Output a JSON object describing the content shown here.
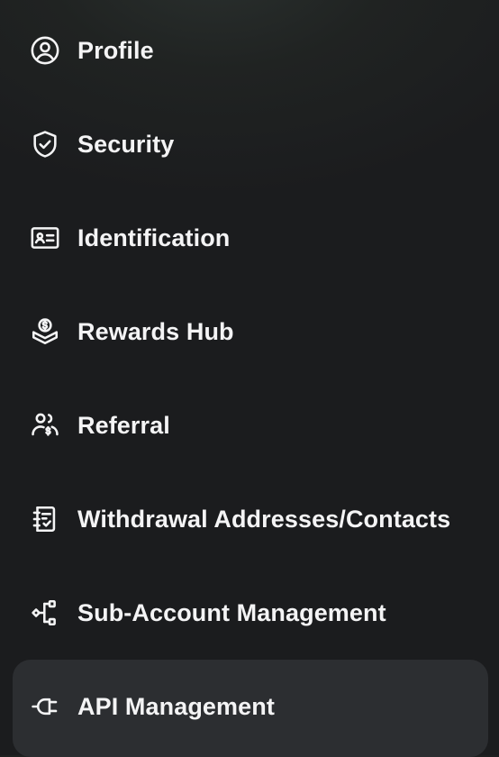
{
  "menu": {
    "items": [
      {
        "label": "Profile",
        "icon": "user-circle-icon"
      },
      {
        "label": "Security",
        "icon": "shield-check-icon"
      },
      {
        "label": "Identification",
        "icon": "id-card-icon"
      },
      {
        "label": "Rewards Hub",
        "icon": "rewards-coin-icon"
      },
      {
        "label": "Referral",
        "icon": "referral-users-icon"
      },
      {
        "label": "Withdrawal Addresses/Contacts",
        "icon": "address-book-icon"
      },
      {
        "label": "Sub-Account Management",
        "icon": "sub-account-tree-icon"
      },
      {
        "label": "API Management",
        "icon": "api-plug-icon"
      }
    ],
    "active_item": "API Management"
  }
}
